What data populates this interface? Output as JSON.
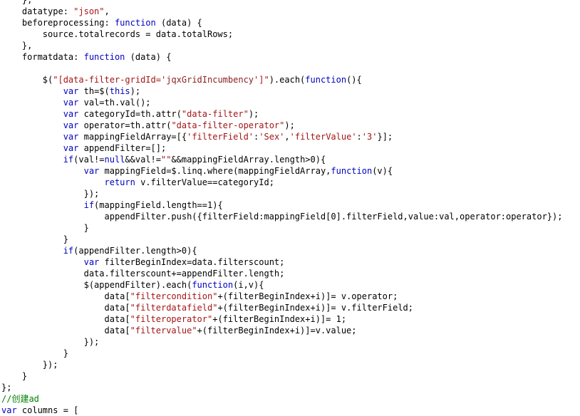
{
  "editor": {
    "language": "javascript",
    "background_color": "#ffffff",
    "default_text_color": "#000000",
    "keyword_color": "#0000c0",
    "string_color": "#a31515",
    "comment_color": "#008000",
    "font_size_px": 12,
    "line_height_px": 16
  },
  "code": {
    "lines": [
      {
        "n": 0,
        "text": "    },",
        "tokens": [
          {
            "t": "    },",
            "c": "plain"
          }
        ]
      },
      {
        "n": 1,
        "text": "    datatype: \"json\",",
        "tokens": [
          {
            "t": "    datatype: ",
            "c": "plain"
          },
          {
            "t": "\"json\"",
            "c": "str"
          },
          {
            "t": ",",
            "c": "plain"
          }
        ]
      },
      {
        "n": 2,
        "text": "    beforeprocessing: function (data) {",
        "tokens": [
          {
            "t": "    beforeprocessing: ",
            "c": "plain"
          },
          {
            "t": "function",
            "c": "kw"
          },
          {
            "t": " (data) {",
            "c": "plain"
          }
        ]
      },
      {
        "n": 3,
        "text": "        source.totalrecords = data.totalRows;",
        "tokens": [
          {
            "t": "        source.totalrecords = data.totalRows;",
            "c": "plain"
          }
        ]
      },
      {
        "n": 4,
        "text": "    },",
        "tokens": [
          {
            "t": "    },",
            "c": "plain"
          }
        ]
      },
      {
        "n": 5,
        "text": "    formatdata: function (data) {",
        "tokens": [
          {
            "t": "    formatdata: ",
            "c": "plain"
          },
          {
            "t": "function",
            "c": "kw"
          },
          {
            "t": " (data) {",
            "c": "plain"
          }
        ]
      },
      {
        "n": 6,
        "text": "",
        "tokens": [
          {
            "t": "",
            "c": "plain"
          }
        ]
      },
      {
        "n": 7,
        "text": "        $(\"[data-filter-gridId='jqxGridIncumbency']\").each(function(){",
        "tokens": [
          {
            "t": "        $(",
            "c": "plain"
          },
          {
            "t": "\"[data-filter-gridId=",
            "c": "str"
          },
          {
            "t": "'jqxGridIncumbency'",
            "c": "str2"
          },
          {
            "t": "]\"",
            "c": "str"
          },
          {
            "t": ").each(",
            "c": "plain"
          },
          {
            "t": "function",
            "c": "kw"
          },
          {
            "t": "(){",
            "c": "plain"
          }
        ]
      },
      {
        "n": 8,
        "text": "            var th=$(this);",
        "tokens": [
          {
            "t": "            ",
            "c": "plain"
          },
          {
            "t": "var",
            "c": "kw"
          },
          {
            "t": " th=$(",
            "c": "plain"
          },
          {
            "t": "this",
            "c": "kw"
          },
          {
            "t": ");",
            "c": "plain"
          }
        ]
      },
      {
        "n": 9,
        "text": "            var val=th.val();",
        "tokens": [
          {
            "t": "            ",
            "c": "plain"
          },
          {
            "t": "var",
            "c": "kw"
          },
          {
            "t": " val=th.val();",
            "c": "plain"
          }
        ]
      },
      {
        "n": 10,
        "text": "            var categoryId=th.attr(\"data-filter\");",
        "tokens": [
          {
            "t": "            ",
            "c": "plain"
          },
          {
            "t": "var",
            "c": "kw"
          },
          {
            "t": " categoryId=th.attr(",
            "c": "plain"
          },
          {
            "t": "\"data-filter\"",
            "c": "str"
          },
          {
            "t": ");",
            "c": "plain"
          }
        ]
      },
      {
        "n": 11,
        "text": "            var operator=th.attr(\"data-filter-operator\");",
        "tokens": [
          {
            "t": "            ",
            "c": "plain"
          },
          {
            "t": "var",
            "c": "kw"
          },
          {
            "t": " operator=th.attr(",
            "c": "plain"
          },
          {
            "t": "\"data-filter-operator\"",
            "c": "str"
          },
          {
            "t": ");",
            "c": "plain"
          }
        ]
      },
      {
        "n": 12,
        "text": "            var mappingFieldArray=[{'filterField':'Sex','filterValue':'3'}];",
        "tokens": [
          {
            "t": "            ",
            "c": "plain"
          },
          {
            "t": "var",
            "c": "kw"
          },
          {
            "t": " mappingFieldArray=[{",
            "c": "plain"
          },
          {
            "t": "'filterField'",
            "c": "str"
          },
          {
            "t": ":",
            "c": "plain"
          },
          {
            "t": "'Sex'",
            "c": "str"
          },
          {
            "t": ",",
            "c": "plain"
          },
          {
            "t": "'filterValue'",
            "c": "str"
          },
          {
            "t": ":",
            "c": "plain"
          },
          {
            "t": "'3'",
            "c": "str"
          },
          {
            "t": "}];",
            "c": "plain"
          }
        ]
      },
      {
        "n": 13,
        "text": "            var appendFilter=[];",
        "tokens": [
          {
            "t": "            ",
            "c": "plain"
          },
          {
            "t": "var",
            "c": "kw"
          },
          {
            "t": " appendFilter=[];",
            "c": "plain"
          }
        ]
      },
      {
        "n": 14,
        "text": "            if(val!=null&&val!=\"\"&&mappingFieldArray.length>0){",
        "tokens": [
          {
            "t": "            ",
            "c": "plain"
          },
          {
            "t": "if",
            "c": "kw"
          },
          {
            "t": "(val!=",
            "c": "plain"
          },
          {
            "t": "null",
            "c": "kw"
          },
          {
            "t": "&&val!=",
            "c": "plain"
          },
          {
            "t": "\"\"",
            "c": "str"
          },
          {
            "t": "&&mappingFieldArray.length>0){",
            "c": "plain"
          }
        ]
      },
      {
        "n": 15,
        "text": "                var mappingField=$.linq.where(mappingFieldArray,function(v){",
        "tokens": [
          {
            "t": "                ",
            "c": "plain"
          },
          {
            "t": "var",
            "c": "kw"
          },
          {
            "t": " mappingField=$.linq.where(mappingFieldArray,",
            "c": "plain"
          },
          {
            "t": "function",
            "c": "kw"
          },
          {
            "t": "(v){",
            "c": "plain"
          }
        ]
      },
      {
        "n": 16,
        "text": "                    return v.filterValue==categoryId;",
        "tokens": [
          {
            "t": "                    ",
            "c": "plain"
          },
          {
            "t": "return",
            "c": "kw"
          },
          {
            "t": " v.filterValue==categoryId;",
            "c": "plain"
          }
        ]
      },
      {
        "n": 17,
        "text": "                });",
        "tokens": [
          {
            "t": "                });",
            "c": "plain"
          }
        ]
      },
      {
        "n": 18,
        "text": "                if(mappingField.length==1){",
        "tokens": [
          {
            "t": "                ",
            "c": "plain"
          },
          {
            "t": "if",
            "c": "kw"
          },
          {
            "t": "(mappingField.length==1){",
            "c": "plain"
          }
        ]
      },
      {
        "n": 19,
        "text": "                    appendFilter.push({filterField:mappingField[0].filterField,value:val,operator:operator});",
        "tokens": [
          {
            "t": "                    appendFilter.push({filterField:mappingField[0].filterField,value:val,operator:operator});",
            "c": "plain"
          }
        ]
      },
      {
        "n": 20,
        "text": "                }",
        "tokens": [
          {
            "t": "                }",
            "c": "plain"
          }
        ]
      },
      {
        "n": 21,
        "text": "            }",
        "tokens": [
          {
            "t": "            }",
            "c": "plain"
          }
        ]
      },
      {
        "n": 22,
        "text": "            if(appendFilter.length>0){",
        "tokens": [
          {
            "t": "            ",
            "c": "plain"
          },
          {
            "t": "if",
            "c": "kw"
          },
          {
            "t": "(appendFilter.length>0){",
            "c": "plain"
          }
        ]
      },
      {
        "n": 23,
        "text": "                var filterBeginIndex=data.filterscount;",
        "tokens": [
          {
            "t": "                ",
            "c": "plain"
          },
          {
            "t": "var",
            "c": "kw"
          },
          {
            "t": " filterBeginIndex=data.filterscount;",
            "c": "plain"
          }
        ]
      },
      {
        "n": 24,
        "text": "                data.filterscount+=appendFilter.length;",
        "tokens": [
          {
            "t": "                data.filterscount+=appendFilter.length;",
            "c": "plain"
          }
        ]
      },
      {
        "n": 25,
        "text": "                $(appendFilter).each(function(i,v){",
        "tokens": [
          {
            "t": "                $(appendFilter).each(",
            "c": "plain"
          },
          {
            "t": "function",
            "c": "kw"
          },
          {
            "t": "(i,v){",
            "c": "plain"
          }
        ]
      },
      {
        "n": 26,
        "text": "                    data[\"filtercondition\"+(filterBeginIndex+i)]= v.operator;",
        "tokens": [
          {
            "t": "                    data[",
            "c": "plain"
          },
          {
            "t": "\"filtercondition\"",
            "c": "str"
          },
          {
            "t": "+(filterBeginIndex+i)]= v.operator;",
            "c": "plain"
          }
        ]
      },
      {
        "n": 27,
        "text": "                    data[\"filterdatafield\"+(filterBeginIndex+i)]= v.filterField;",
        "tokens": [
          {
            "t": "                    data[",
            "c": "plain"
          },
          {
            "t": "\"filterdatafield\"",
            "c": "str"
          },
          {
            "t": "+(filterBeginIndex+i)]= v.filterField;",
            "c": "plain"
          }
        ]
      },
      {
        "n": 28,
        "text": "                    data[\"filteroperator\"+(filterBeginIndex+i)]= 1;",
        "tokens": [
          {
            "t": "                    data[",
            "c": "plain"
          },
          {
            "t": "\"filteroperator\"",
            "c": "str"
          },
          {
            "t": "+(filterBeginIndex+i)]= 1;",
            "c": "plain"
          }
        ]
      },
      {
        "n": 29,
        "text": "                    data[\"filtervalue\"+(filterBeginIndex+i)]=v.value;",
        "tokens": [
          {
            "t": "                    data[",
            "c": "plain"
          },
          {
            "t": "\"filtervalue\"",
            "c": "str"
          },
          {
            "t": "+(filterBeginIndex+i)]=v.value;",
            "c": "plain"
          }
        ]
      },
      {
        "n": 30,
        "text": "                });",
        "tokens": [
          {
            "t": "                });",
            "c": "plain"
          }
        ]
      },
      {
        "n": 31,
        "text": "            }",
        "tokens": [
          {
            "t": "            }",
            "c": "plain"
          }
        ]
      },
      {
        "n": 32,
        "text": "        });",
        "tokens": [
          {
            "t": "        });",
            "c": "plain"
          }
        ]
      },
      {
        "n": 33,
        "text": "    }",
        "tokens": [
          {
            "t": "    }",
            "c": "plain"
          }
        ]
      },
      {
        "n": 34,
        "text": "};",
        "tokens": [
          {
            "t": "};",
            "c": "plain"
          }
        ]
      },
      {
        "n": 35,
        "text": "//创建ad",
        "tokens": [
          {
            "t": "//创建ad",
            "c": "comment"
          }
        ]
      },
      {
        "n": 36,
        "text": "var columns = [",
        "tokens": [
          {
            "t": "var",
            "c": "kw"
          },
          {
            "t": " columns = [",
            "c": "plain"
          }
        ]
      }
    ]
  }
}
